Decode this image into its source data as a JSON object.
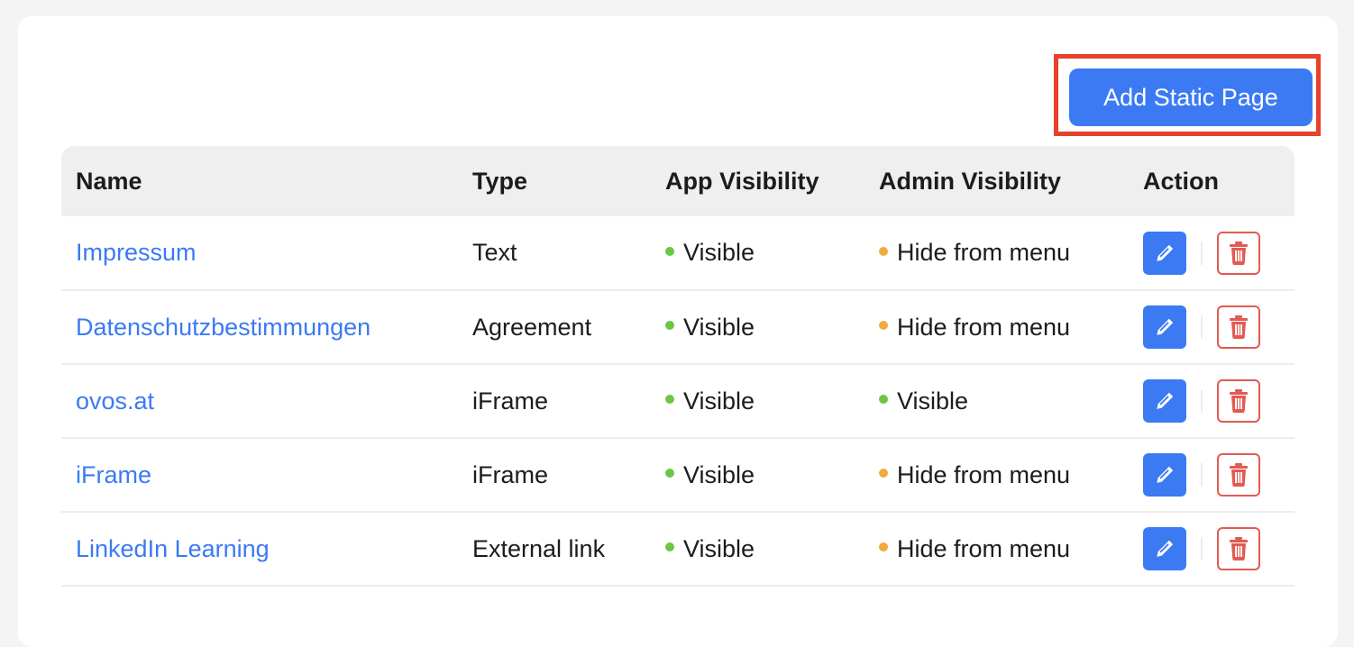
{
  "toolbar": {
    "add_label": "Add Static Page"
  },
  "colors": {
    "accent": "#3b7af3",
    "visible": "#6cc644",
    "hidden": "#f0ab3c",
    "danger": "#e25a52",
    "highlight": "#e8402a"
  },
  "table": {
    "headers": [
      "Name",
      "Type",
      "App Visibility",
      "Admin Visibility",
      "Action"
    ],
    "rows": [
      {
        "name": "Impressum",
        "type": "Text",
        "app": "Visible",
        "app_status": "visible",
        "admin": "Hide from menu",
        "admin_status": "hidden"
      },
      {
        "name": "Datenschutzbestimmungen",
        "type": "Agreement",
        "app": "Visible",
        "app_status": "visible",
        "admin": "Hide from menu",
        "admin_status": "hidden"
      },
      {
        "name": "ovos.at",
        "type": "iFrame",
        "app": "Visible",
        "app_status": "visible",
        "admin": "Visible",
        "admin_status": "visible"
      },
      {
        "name": "iFrame",
        "type": "iFrame",
        "app": "Visible",
        "app_status": "visible",
        "admin": "Hide from menu",
        "admin_status": "hidden"
      },
      {
        "name": "LinkedIn Learning",
        "type": "External link",
        "app": "Visible",
        "app_status": "visible",
        "admin": "Hide from menu",
        "admin_status": "hidden"
      }
    ],
    "action_icons": {
      "edit": "pencil-icon",
      "delete": "trash-icon"
    }
  }
}
